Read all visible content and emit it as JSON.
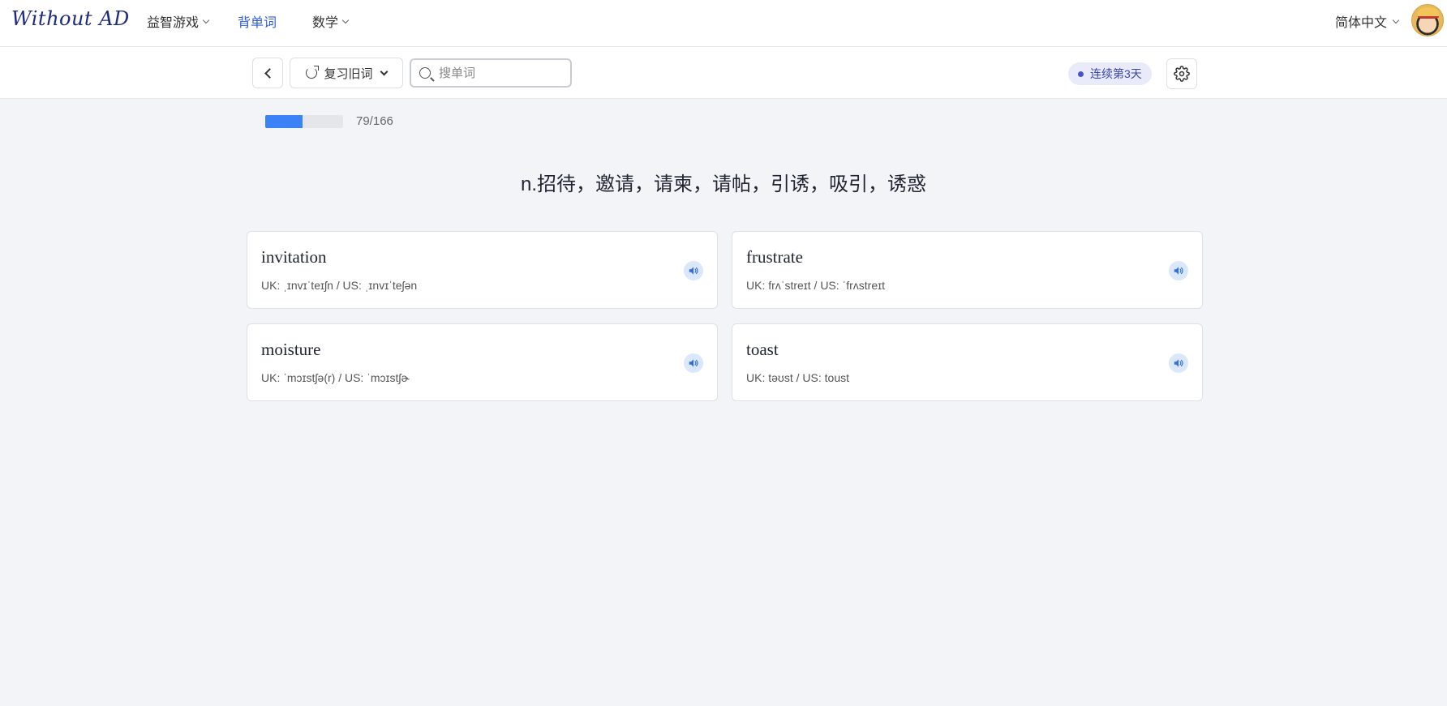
{
  "nav": {
    "logo": "Without AD",
    "items": [
      {
        "label": "益智游戏",
        "has_dropdown": true
      },
      {
        "label": "背单词",
        "has_dropdown": false,
        "active": true
      },
      {
        "label": "数学",
        "has_dropdown": true
      }
    ],
    "language": "简体中文"
  },
  "toolbar": {
    "review_label": "复习旧词",
    "search_placeholder": "搜单词",
    "streak_label": "连续第3天"
  },
  "progress": {
    "current": 79,
    "total": 166,
    "text": "79/166"
  },
  "definition": "n.招待，邀请，请柬，请帖，引诱，吸引，诱惑",
  "cards": [
    {
      "word": "invitation",
      "phonetic": "UK: ˌɪnvɪˈteɪʃn / US: ˌɪnvɪˈteʃən"
    },
    {
      "word": "frustrate",
      "phonetic": "UK: frʌˈstreɪt / US: ˈfrʌstreɪt"
    },
    {
      "word": "moisture",
      "phonetic": "UK: ˈmɔɪstʃə(r) / US: ˈmɔɪstʃɚ"
    },
    {
      "word": "toast",
      "phonetic": "UK: təʊst / US: toust"
    }
  ],
  "colors": {
    "accent": "#3b82f6",
    "nav_active": "#2f5fd0",
    "streak_bg": "#e9ebfb"
  },
  "icons": [
    "chevron-down-icon",
    "chevron-left-icon",
    "refresh-icon",
    "search-icon",
    "gear-icon",
    "speaker-icon"
  ]
}
